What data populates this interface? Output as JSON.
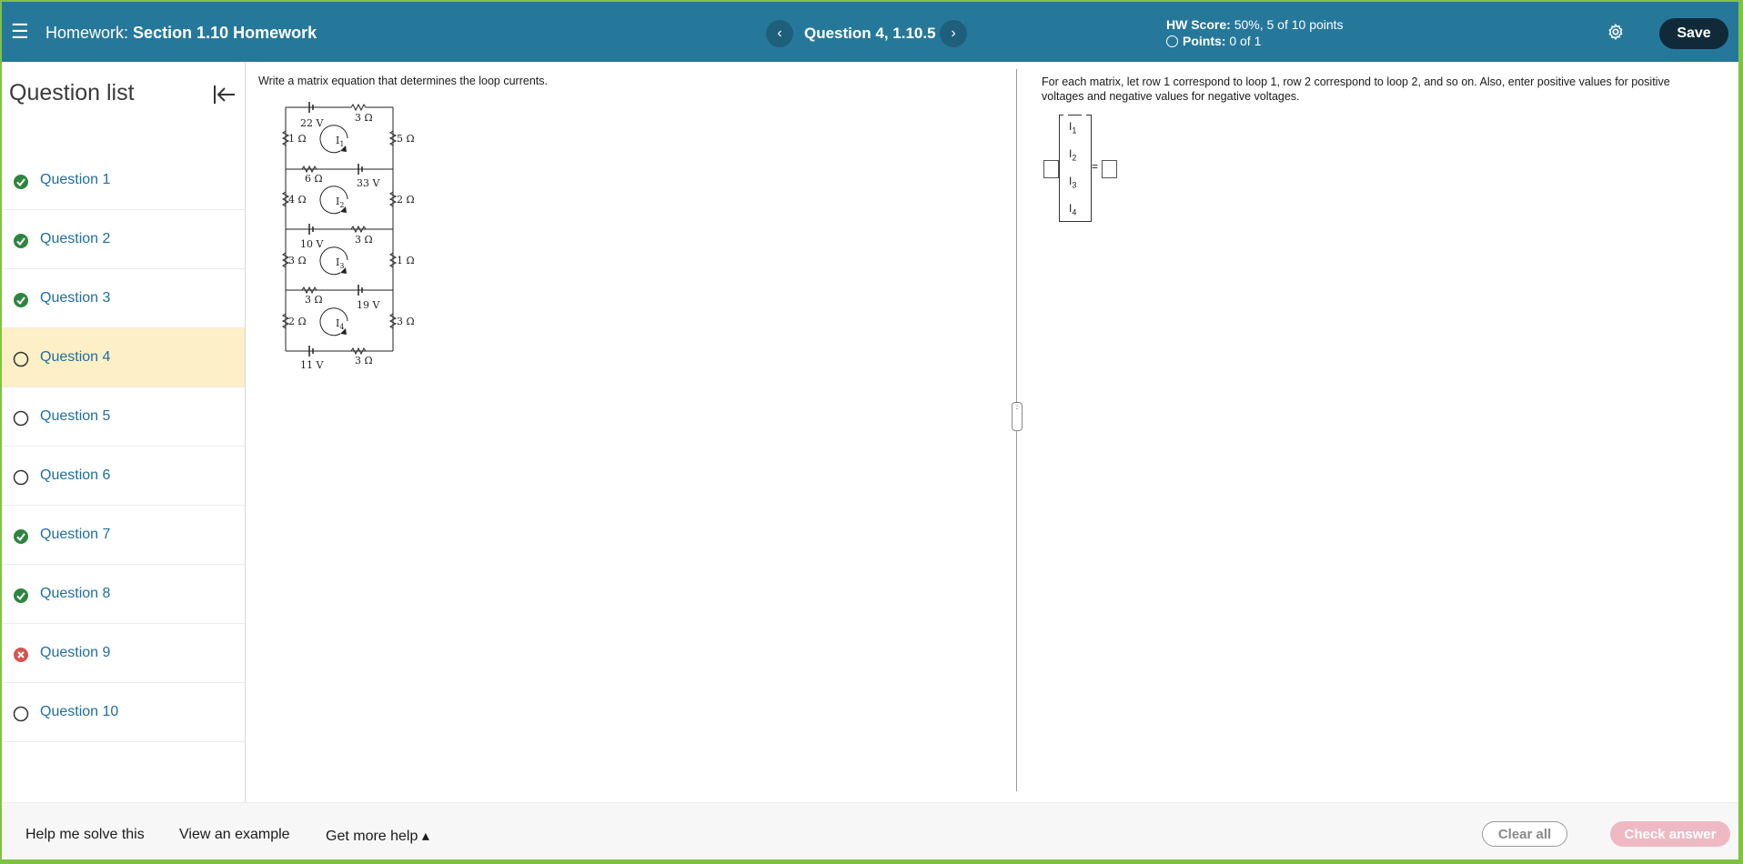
{
  "header": {
    "menu_icon": "hamburger-icon",
    "title_prefix": "Homework:",
    "title": "Section 1.10 Homework",
    "prev_icon": "‹",
    "next_icon": "›",
    "question_title": "Question 4, 1.10.5",
    "hw_score_label": "HW Score:",
    "hw_score_value": "50%, 5 of 10 points",
    "points_label": "Points:",
    "points_value": "0 of 1",
    "settings_icon": "gear-icon",
    "save_label": "Save"
  },
  "sidebar": {
    "title": "Question list",
    "collapse_icon": "collapse-left-icon",
    "questions": [
      {
        "label": "Question 1",
        "status": "correct"
      },
      {
        "label": "Question 2",
        "status": "correct"
      },
      {
        "label": "Question 3",
        "status": "correct"
      },
      {
        "label": "Question 4",
        "status": "unanswered",
        "current": true
      },
      {
        "label": "Question 5",
        "status": "unanswered"
      },
      {
        "label": "Question 6",
        "status": "unanswered"
      },
      {
        "label": "Question 7",
        "status": "correct"
      },
      {
        "label": "Question 8",
        "status": "correct"
      },
      {
        "label": "Question 9",
        "status": "incorrect"
      },
      {
        "label": "Question 10",
        "status": "unanswered"
      }
    ]
  },
  "question": {
    "prompt": "Write a matrix equation that determines the loop currents.",
    "instructions": "For each matrix, let row 1 correspond to loop 1, row 2 correspond to loop 2, and so on. Also, enter positive values for positive voltages and negative values for negative voltages.",
    "matrix_vars": [
      {
        "name": "I",
        "sub": "1"
      },
      {
        "name": "I",
        "sub": "2"
      },
      {
        "name": "I",
        "sub": "3"
      },
      {
        "name": "I",
        "sub": "4"
      }
    ],
    "equals": "=",
    "circuit": {
      "labels": [
        "22 V",
        "3 Ω",
        "1 Ω",
        "5 Ω",
        "6 Ω",
        "33 V",
        "4 Ω",
        "2 Ω",
        "10 V",
        "3 Ω",
        "3 Ω",
        "1 Ω",
        "3 Ω",
        "19 V",
        "2 Ω",
        "3 Ω",
        "11 V",
        "3 Ω"
      ],
      "loops": [
        "I1",
        "I2",
        "I3",
        "I4"
      ]
    }
  },
  "footer": {
    "help_solve": "Help me solve this",
    "view_example": "View an example",
    "more_help": "Get more help ▴",
    "clear_all": "Clear all",
    "check_answer": "Check answer"
  },
  "colors": {
    "header_bg": "#26789b",
    "correct": "#2e8540",
    "incorrect": "#d9534f",
    "link": "#1d6ea0",
    "current_bg": "#fdefc6",
    "outer_border": "#7fc241"
  }
}
